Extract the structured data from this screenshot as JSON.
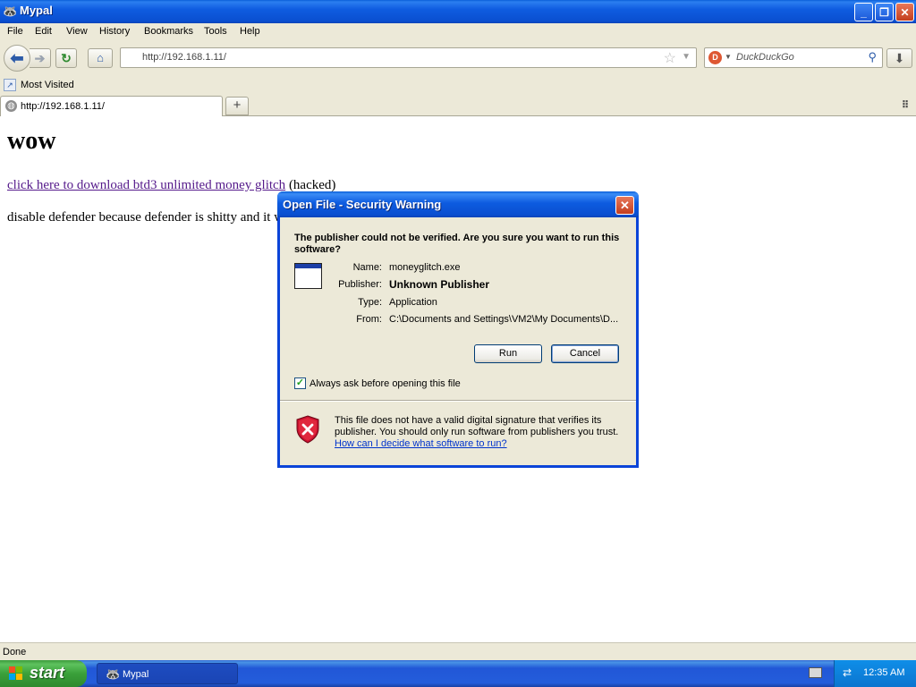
{
  "window": {
    "title": "Mypal",
    "minimize": "_",
    "maximize": "❐",
    "close": "✕"
  },
  "menu": {
    "items": [
      {
        "label": "File"
      },
      {
        "label": "Edit"
      },
      {
        "label": "View"
      },
      {
        "label": "History"
      },
      {
        "label": "Bookmarks"
      },
      {
        "label": "Tools"
      },
      {
        "label": "Help"
      }
    ]
  },
  "navbar": {
    "url": "http://192.168.1.11/",
    "search_placeholder": "DuckDuckGo",
    "icons": [
      "back-icon",
      "forward-icon",
      "reload-icon",
      "home-icon",
      "bookmark-star-icon",
      "search-icon",
      "download-icon"
    ]
  },
  "bookmarks_bar": {
    "items": [
      {
        "label": "Most Visited"
      }
    ]
  },
  "tabs": [
    {
      "label": "http://192.168.1.11/",
      "active": true
    }
  ],
  "page": {
    "heading": "wow",
    "link_text": "click here to download btd3 unlimited money glitch",
    "link_suffix": " (hacked)",
    "paragraph": "disable defender because defender is shitty and it w"
  },
  "status": {
    "text": "Done"
  },
  "dialog": {
    "title": "Open File - Security Warning",
    "question": "The publisher could not be verified.  Are you sure you want to run this software?",
    "fields": {
      "name_label": "Name:",
      "name_value": "moneyglitch.exe",
      "publisher_label": "Publisher:",
      "publisher_value": "Unknown Publisher",
      "type_label": "Type:",
      "type_value": "Application",
      "from_label": "From:",
      "from_value": "C:\\Documents and Settings\\VM2\\My Documents\\D..."
    },
    "run_label": "Run",
    "cancel_label": "Cancel",
    "checkbox_label": "Always ask before opening this file",
    "checkbox_checked": true,
    "warning_text": "This file does not have a valid digital signature that verifies its publisher.  You should only run software from publishers you trust.",
    "help_link": "How can I decide what software to run?"
  },
  "taskbar": {
    "start_label": "start",
    "items": [
      {
        "label": "Mypal"
      }
    ],
    "clock": "12:35 AM"
  },
  "colors": {
    "xp_blue": "#0a4fd0",
    "start_green": "#3aa03a",
    "link_visited": "#551a8b",
    "dialog_bg": "#ece9d8"
  }
}
